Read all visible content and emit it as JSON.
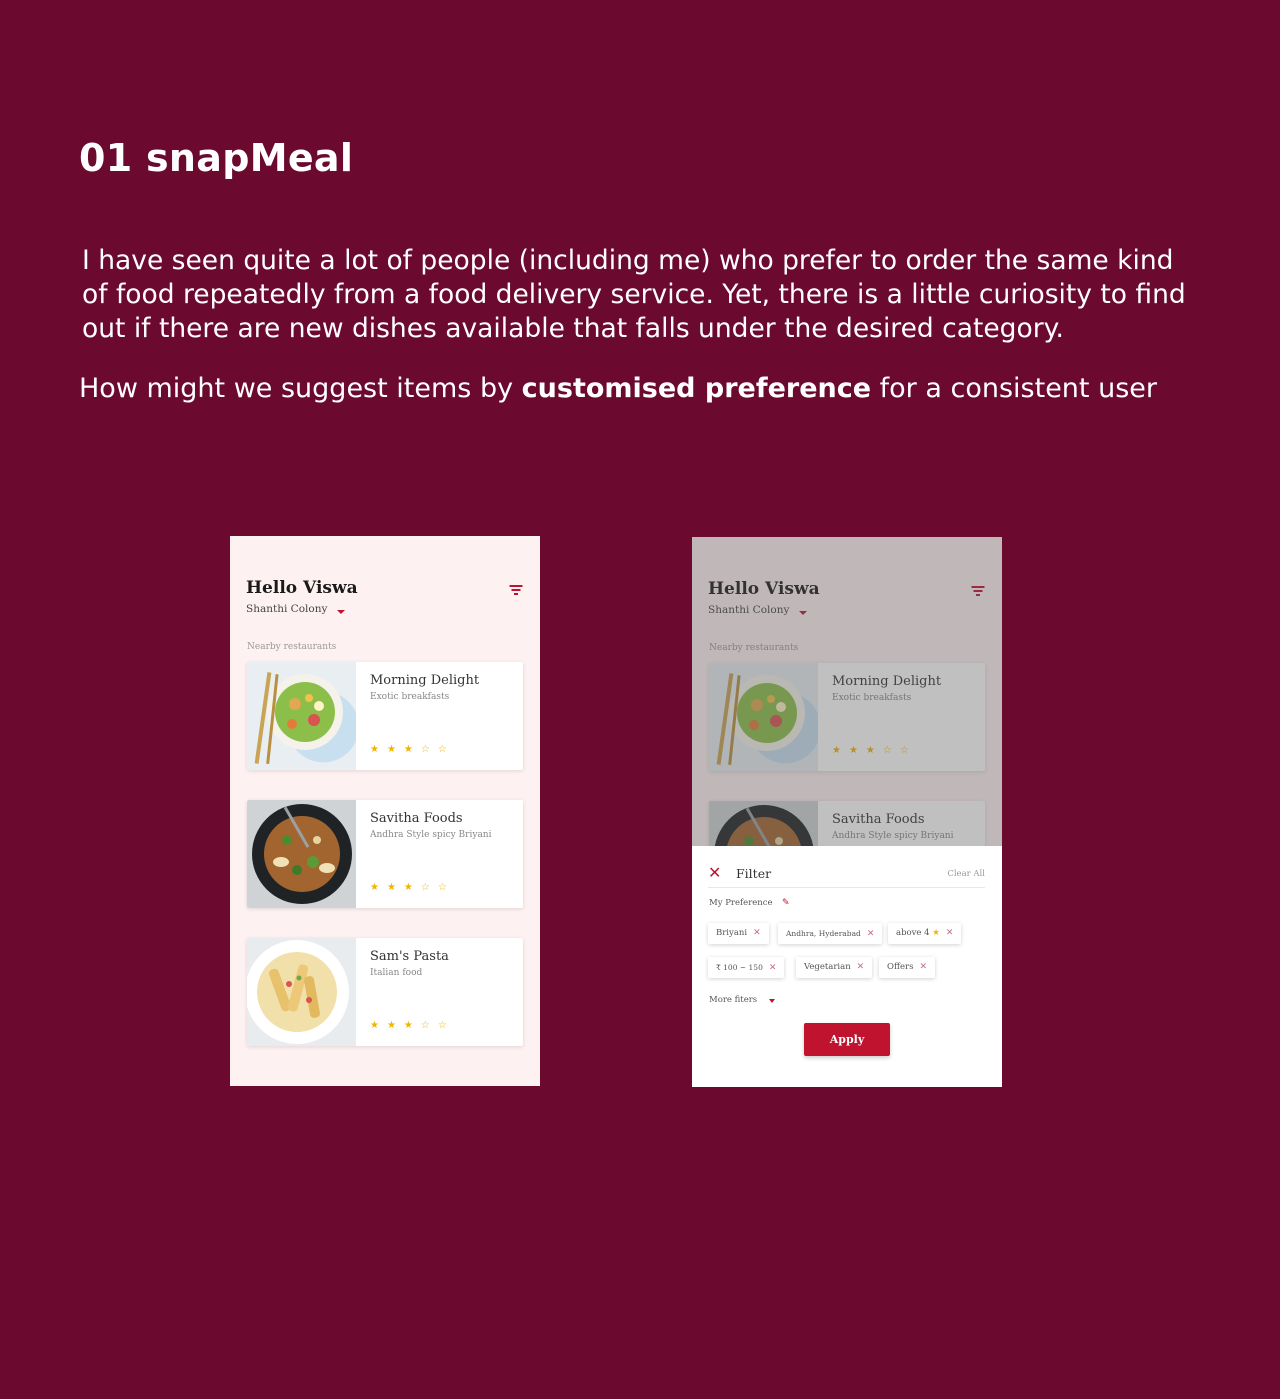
{
  "page": {
    "title": "01 snapMeal",
    "intro": "I have seen quite a lot of people (including me) who prefer to order the same kind of food repeatedly from a food delivery service. Yet, there is a little curiosity to find out if there are new dishes available that falls under the desired category.",
    "question_prefix": "How might we suggest items by ",
    "question_emphasis": "customised preference",
    "question_suffix": " for a consistent user"
  },
  "app": {
    "greeting": "Hello Viswa",
    "location": "Shanthi Colony",
    "section_label": "Nearby restaurants",
    "restaurants": [
      {
        "name": "Morning Delight",
        "subtitle": "Exotic breakfasts",
        "rating": 3,
        "max": 5,
        "stars": "★★★☆☆",
        "image": "salad-photo"
      },
      {
        "name": "Savitha Foods",
        "subtitle": "Andhra Style spicy Briyani",
        "rating": 3,
        "max": 5,
        "stars": "★★★☆☆",
        "image": "biryani-photo"
      },
      {
        "name": "Sam's Pasta",
        "subtitle": "Italian food",
        "rating": 3,
        "max": 5,
        "stars": "★★★☆☆",
        "image": "pasta-photo"
      }
    ]
  },
  "filter": {
    "title": "Filter",
    "clear_all": "Clear All",
    "preference_label": "My Preference",
    "chips": [
      "Briyani",
      "Andhra, Hyderabad",
      "above 4",
      "₹ 100 ~ 150",
      "Vegetarian",
      "Offers"
    ],
    "more_filters": "More fiters",
    "apply": "Apply"
  },
  "colors": {
    "background": "#6b092f",
    "accent": "#c0132f",
    "star": "#f1b400",
    "screen": "#fdf1f2"
  },
  "icons": [
    "filter-icon",
    "caret-down-icon",
    "close-icon",
    "pencil-icon",
    "star-icon"
  ]
}
